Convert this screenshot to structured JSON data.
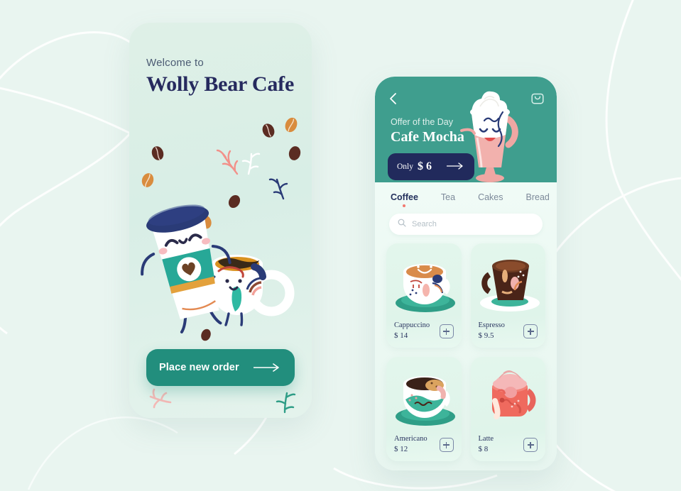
{
  "palette": {
    "page_bg": "#e9f5f0",
    "teal": "#3f9e8e",
    "teal_button": "#228e7d",
    "navy": "#262a5e",
    "navy_pill": "#212a5c",
    "coral": "#f2796f",
    "card_bg": "#e3f6ec"
  },
  "left_screen": {
    "welcome_text": "Welcome to",
    "brand_title": "Wolly Bear Cafe",
    "cta": {
      "label": "Place new order",
      "arrow_icon": "arrow-right-icon"
    },
    "illustration": {
      "characters": [
        "takeaway-coffee-cup-character",
        "coffee-mug-character"
      ],
      "decorations": [
        "coffee-bean",
        "leaf-sprig"
      ]
    }
  },
  "right_screen": {
    "header": {
      "back_icon": "chevron-left-icon",
      "cart_icon": "shopping-bag-icon",
      "subtitle": "Offer of the Day",
      "title": "Cafe Mocha",
      "pill": {
        "prefix": "Only",
        "price": "$ 6",
        "arrow_icon": "arrow-right-icon"
      },
      "illustration": "milkshake-glass-character"
    },
    "tabs": [
      {
        "label": "Coffee",
        "active": true
      },
      {
        "label": "Tea",
        "active": false
      },
      {
        "label": "Cakes",
        "active": false
      },
      {
        "label": "Bread",
        "active": false
      }
    ],
    "search": {
      "icon": "search-icon",
      "placeholder": "Search"
    },
    "products": [
      {
        "name": "Cappuccino",
        "price": "$ 14",
        "art": "cappuccino-cup",
        "add_icon": "plus-icon"
      },
      {
        "name": "Espresso",
        "price": "$ 9.5",
        "art": "espresso-mug",
        "add_icon": "plus-icon"
      },
      {
        "name": "Americano",
        "price": "$ 12",
        "art": "americano-cup",
        "add_icon": "plus-icon"
      },
      {
        "name": "Latte",
        "price": "$ 8",
        "art": "latte-mug",
        "add_icon": "plus-icon"
      }
    ]
  }
}
